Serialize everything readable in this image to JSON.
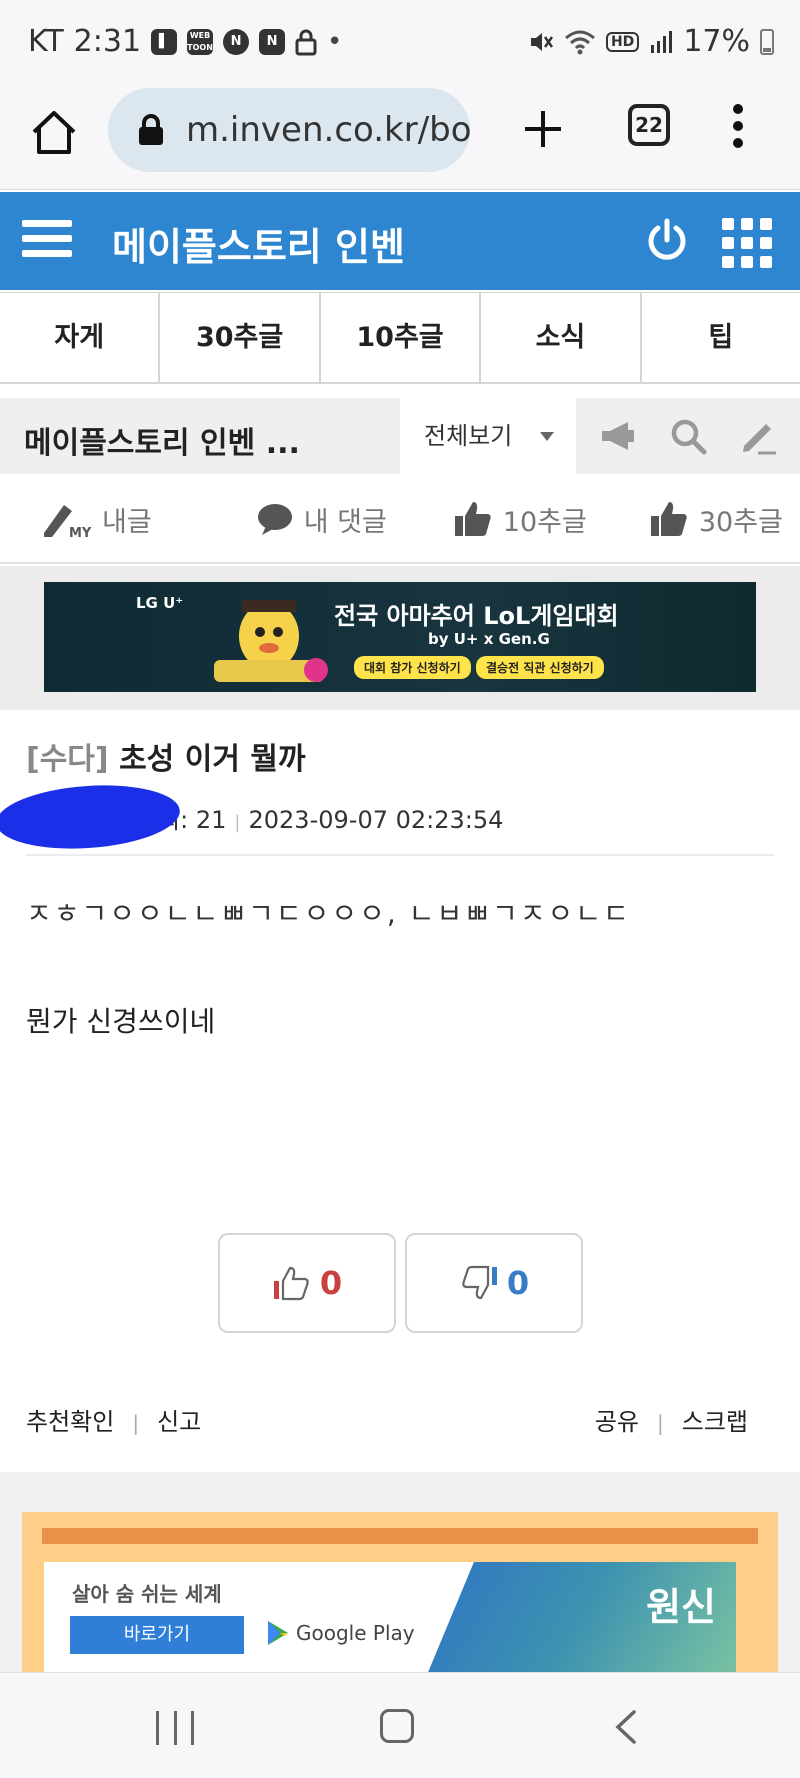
{
  "status_bar": {
    "carrier": "KT",
    "time": "2:31",
    "app_icons": [
      "twitch-icon",
      "webtoon-icon",
      "naver-icon",
      "naver-icon",
      "lock-icon"
    ],
    "webtoon_text": "WEB TOON",
    "naver_letter": "N",
    "battery": "17%"
  },
  "browser": {
    "url": "m.inven.co.kr/bo",
    "tab_count": "22"
  },
  "header": {
    "site_title": "메이플스토리 인벤"
  },
  "category_tabs": [
    "자게",
    "30추글",
    "10추글",
    "소식",
    "팁"
  ],
  "board": {
    "title": "메이플스토리 인벤 ...",
    "view_select": "전체보기"
  },
  "my_actions": [
    {
      "label": "내글",
      "icon": "pencil-my-icon"
    },
    {
      "label": "내 댓글",
      "icon": "comment-icon"
    },
    {
      "label": "10추글",
      "icon": "thumb-up-icon"
    },
    {
      "label": "30추글",
      "icon": "thumb-up-icon"
    }
  ],
  "ad_banner": {
    "logo": "LG U⁺",
    "headline": "전국 아마추어 LoL게임대회",
    "sub": "by U+ x Gen.G",
    "button1": "대회 참가 신청하기",
    "button2": "결승전 직관 신청하기"
  },
  "post": {
    "category": "[수다]",
    "title": "초성 이거 뭘까",
    "views": "조회: 21",
    "date": "2023-09-07 02:23:54",
    "body_line1": "ㅈㅎㄱㅇㅇㄴㄴㅃㄱㄷㅇㅇㅇ, ㄴㅂㅃㄱㅈㅇㄴㄷ",
    "body_line2": "뭔가 신경쓰이네"
  },
  "votes": {
    "up": "0",
    "down": "0"
  },
  "post_links": {
    "recommend_check": "추천확인",
    "report": "신고",
    "share": "공유",
    "scrap": "스크랩"
  },
  "game_ad": {
    "tagline": "살아 숨 쉬는 세계",
    "button": "바로가기",
    "store": "Google Play",
    "game_title": "원신"
  },
  "colors": {
    "header_blue": "#2e86d1",
    "vote_up": "#c94040",
    "vote_down": "#3a7bc8"
  }
}
